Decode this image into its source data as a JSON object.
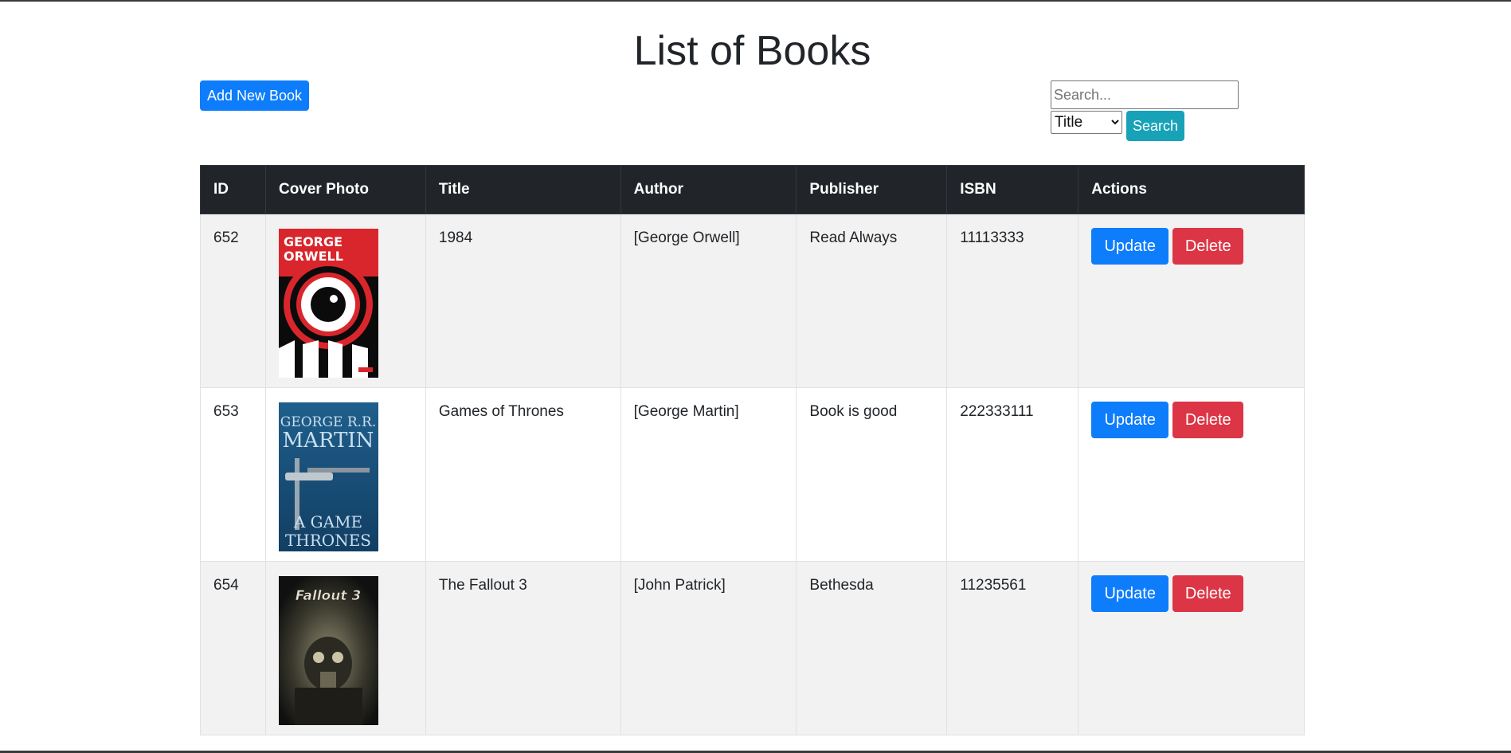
{
  "page": {
    "title": "List of Books"
  },
  "toolbar": {
    "add_label": "Add New Book"
  },
  "search": {
    "placeholder": "Search...",
    "value": "",
    "field_selected": "Title",
    "button_label": "Search"
  },
  "table": {
    "headers": [
      "ID",
      "Cover Photo",
      "Title",
      "Author",
      "Publisher",
      "ISBN",
      "Actions"
    ],
    "rows": [
      {
        "id": "652",
        "cover": "cover-1984",
        "title": "1984",
        "author": "[George Orwell]",
        "publisher": "Read Always",
        "isbn": "11113333"
      },
      {
        "id": "653",
        "cover": "cover-game-of-thrones",
        "title": "Games of Thrones",
        "author": "[George Martin]",
        "publisher": "Book is good",
        "isbn": "222333111"
      },
      {
        "id": "654",
        "cover": "cover-fallout-3",
        "title": "The Fallout 3",
        "author": "[John Patrick]",
        "publisher": "Bethesda",
        "isbn": "11235561"
      }
    ],
    "update_label": "Update",
    "delete_label": "Delete"
  },
  "colors": {
    "primary": "#0d7dfc",
    "danger": "#dc3545",
    "info": "#17a2b8",
    "header_bg": "#212529",
    "stripe": "#f2f2f2"
  }
}
